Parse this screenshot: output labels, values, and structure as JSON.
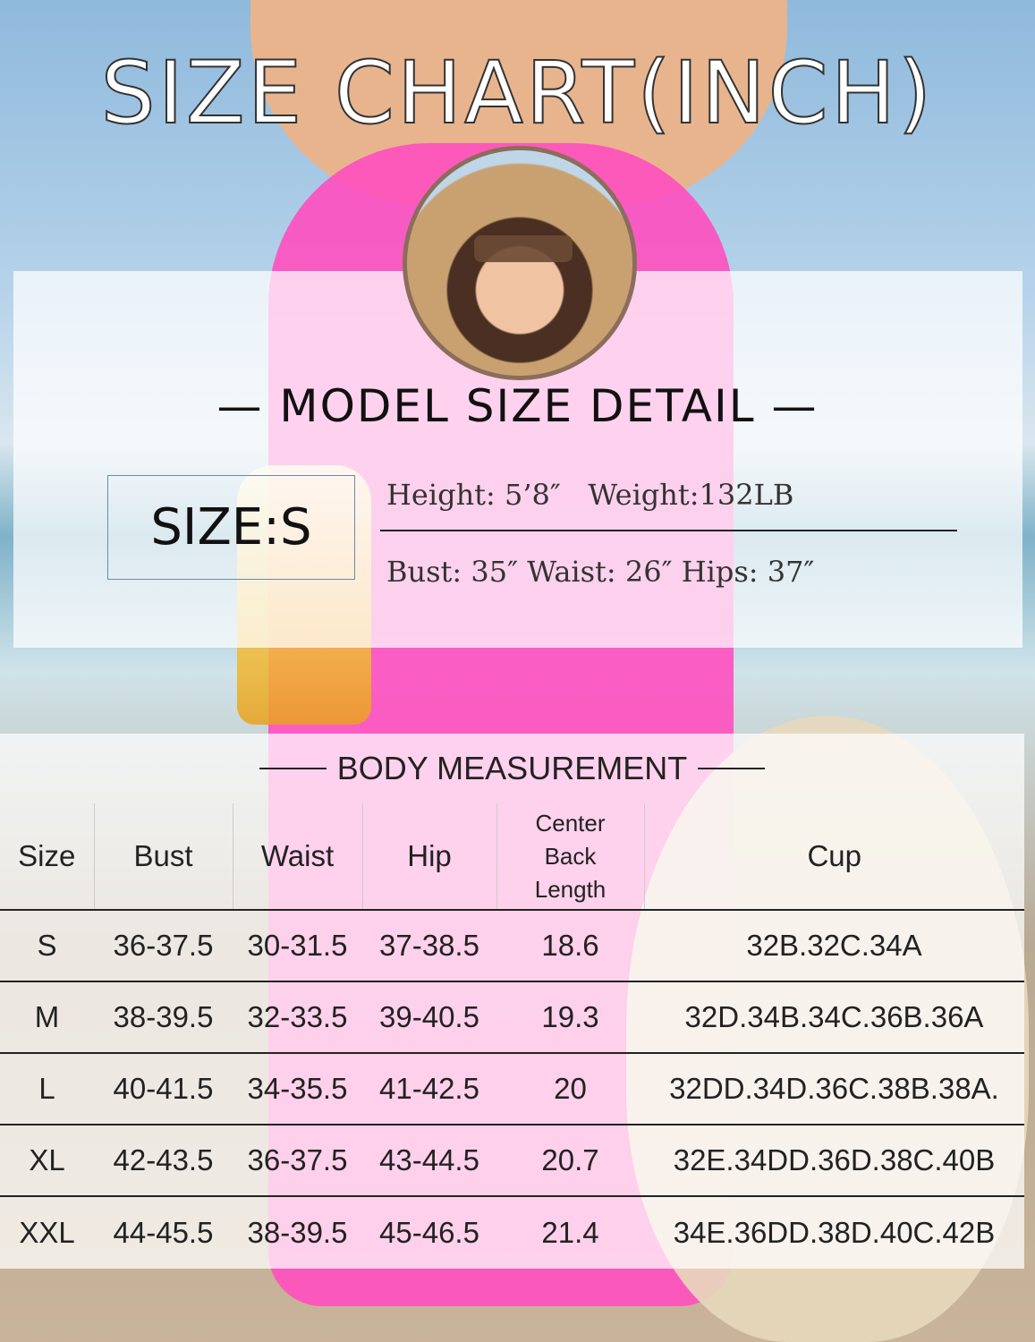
{
  "title": "SIZE CHART(INCH)",
  "model": {
    "heading": "— MODEL SIZE DETAIL —",
    "size_label": "SIZE:S",
    "line1": "Height: 5’8″   Weight:132LB",
    "line2": "Bust: 35″ Waist: 26″ Hips: 37″"
  },
  "table": {
    "title": "BODY MEASUREMENT",
    "headers": [
      "Size",
      "Bust",
      "Waist",
      "Hip",
      "Center Back Length",
      "Cup"
    ],
    "rows": [
      [
        "S",
        "36-37.5",
        "30-31.5",
        "37-38.5",
        "18.6",
        "32B.32C.34A"
      ],
      [
        "M",
        "38-39.5",
        "32-33.5",
        "39-40.5",
        "19.3",
        "32D.34B.34C.36B.36A"
      ],
      [
        "L",
        "40-41.5",
        "34-35.5",
        "41-42.5",
        "20",
        "32DD.34D.36C.38B.38A."
      ],
      [
        "XL",
        "42-43.5",
        "36-37.5",
        "43-44.5",
        "20.7",
        "32E.34DD.36D.38C.40B"
      ],
      [
        "XXL",
        "44-45.5",
        "38-39.5",
        "45-46.5",
        "21.4",
        "34E.36DD.38D.40C.42B"
      ]
    ]
  }
}
